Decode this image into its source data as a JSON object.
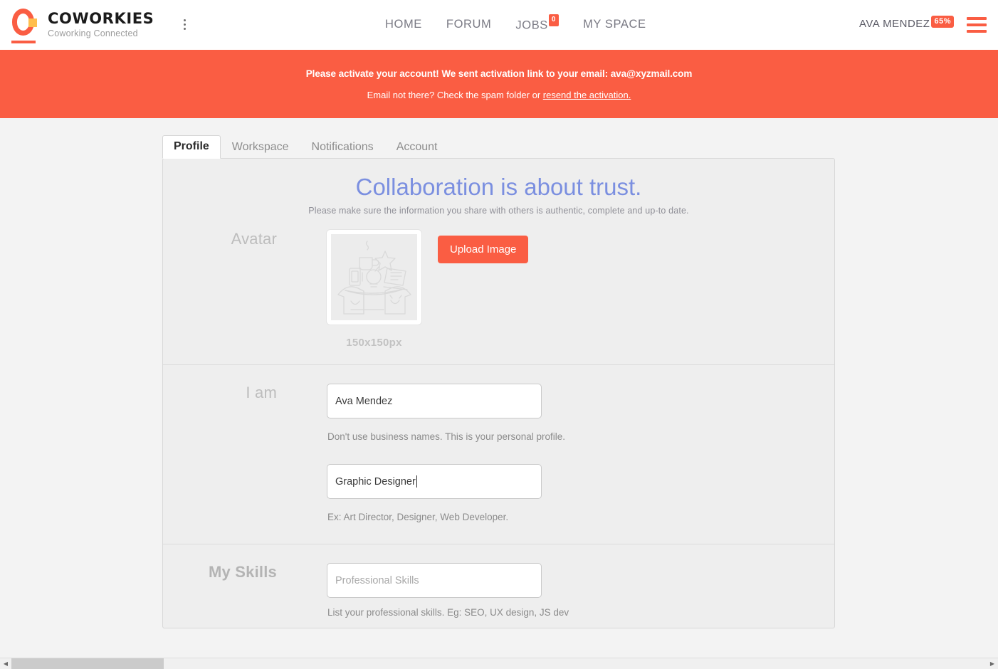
{
  "brand": {
    "name": "COWORKIES",
    "tagline": "Coworking Connected",
    "logo_icon": "coworkies-o-logo",
    "menu_icon": "kebab-menu-icon",
    "accent_color": "#fa5d43",
    "accent_secondary_color": "#ffbe4d"
  },
  "nav": {
    "items": [
      {
        "label": "HOME",
        "badge": null
      },
      {
        "label": "FORUM",
        "badge": null
      },
      {
        "label": "JOBS",
        "badge": "0"
      },
      {
        "label": "MY SPACE",
        "badge": null
      }
    ]
  },
  "user": {
    "name": "AVA MENDEZ",
    "completion_badge": "65%",
    "menu_icon": "hamburger-menu-icon"
  },
  "alert": {
    "title": "Please activate your account! We sent activation link to your email: ava@xyzmail.com",
    "sub_prefix": "Email not there? Check the spam folder or ",
    "link_label": "resend the activation.",
    "background_color": "#fa5d43"
  },
  "tabs": [
    {
      "label": "Profile",
      "active": true
    },
    {
      "label": "Workspace",
      "active": false
    },
    {
      "label": "Notifications",
      "active": false
    },
    {
      "label": "Account",
      "active": false
    }
  ],
  "hero": {
    "title": "Collaboration is about trust.",
    "title_color": "#7b8fe0",
    "subtitle": "Please make sure the information you share with others is authentic, complete and up-to date."
  },
  "avatar_section": {
    "label": "Avatar",
    "placeholder_icon": "coworkers-desk-illustration",
    "size_caption": "150x150px",
    "upload_button": "Upload Image"
  },
  "iam_section": {
    "label": "I am",
    "name_value": "Ava Mendez",
    "name_hint": "Don't use business names. This is your personal profile.",
    "role_value": "Graphic Designer",
    "role_hint": "Ex: Art Director, Designer, Web Developer.",
    "role_focused": true
  },
  "skills_section": {
    "label": "My Skills",
    "placeholder": "Professional Skills",
    "hint": "List your professional skills. Eg: SEO, UX design, JS dev"
  },
  "scrollbar": {
    "left_arrow_icon": "chevron-left-icon",
    "right_arrow_icon": "chevron-right-icon"
  }
}
